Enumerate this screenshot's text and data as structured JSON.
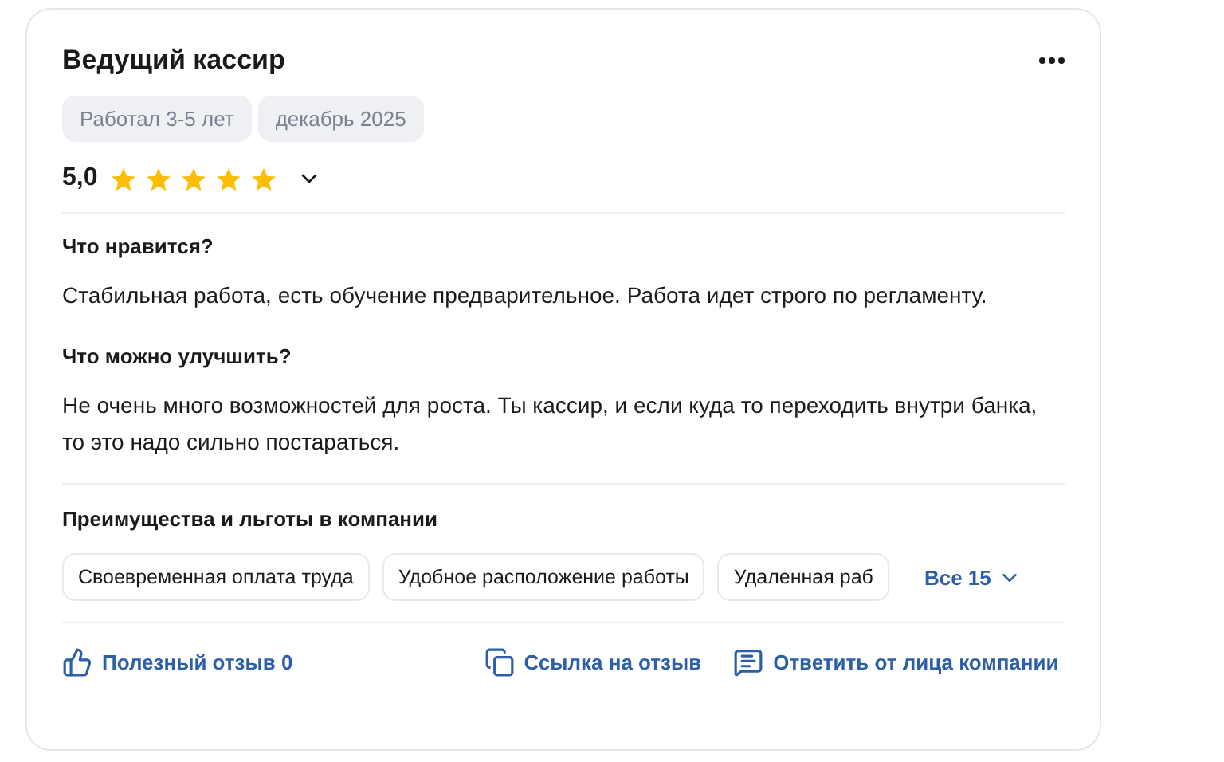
{
  "review": {
    "title": "Ведущий кассир",
    "tags": [
      "Работал 3-5 лет",
      "декабрь 2025"
    ],
    "rating": "5,0",
    "stars": 5,
    "sections": [
      {
        "heading": "Что нравится?",
        "text": "Стабильная работа, есть обучение предварительное. Работа идет строго по регламенту."
      },
      {
        "heading": "Что можно улучшить?",
        "text": "Не очень много возможностей для роста. Ты кассир, и если куда то переходить внутри банка, то это надо сильно постараться."
      }
    ],
    "benefits": {
      "heading": "Преимущества и льготы в компании",
      "items": [
        "Своевременная оплата труда",
        "Удобное расположение работы",
        "Удаленная раб"
      ],
      "more": "Все 15"
    },
    "actions": {
      "useful": "Полезный отзыв 0",
      "link": "Ссылка на отзыв",
      "reply": "Ответить от лица компании"
    }
  }
}
